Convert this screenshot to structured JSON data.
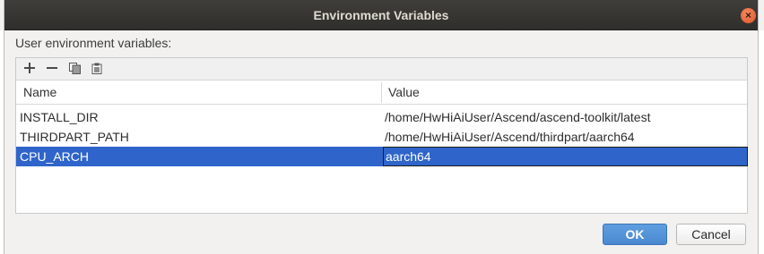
{
  "window": {
    "title": "Environment Variables",
    "close_glyph": "×"
  },
  "section": {
    "label": "User environment variables:"
  },
  "toolbar": {
    "add_icon": "plus-icon",
    "remove_icon": "minus-icon",
    "copy_icon": "copy-icon",
    "paste_icon": "paste-icon"
  },
  "table": {
    "columns": [
      "Name",
      "Value"
    ],
    "rows": [
      {
        "name": "INSTALL_DIR",
        "value": "/home/HwHiAiUser/Ascend/ascend-toolkit/latest"
      },
      {
        "name": "THIRDPART_PATH",
        "value": "/home/HwHiAiUser/Ascend/thirdpart/aarch64"
      },
      {
        "name": "CPU_ARCH",
        "value": "aarch64"
      }
    ],
    "selected_row": 2
  },
  "buttons": {
    "ok": "OK",
    "cancel": "Cancel"
  },
  "colors": {
    "accent": "#2f65ca",
    "ok_button": "#4a89cf",
    "titlebar": "#3a3935",
    "close_button": "#e0532b"
  }
}
